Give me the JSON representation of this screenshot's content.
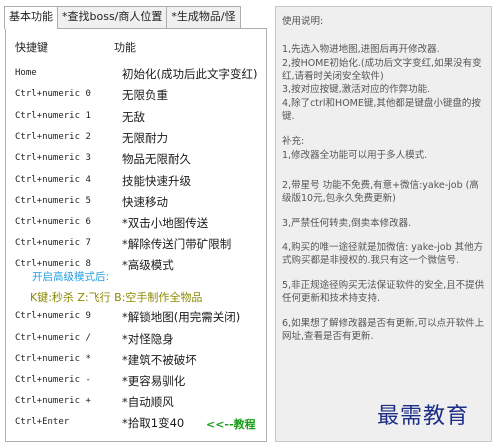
{
  "tabs": [
    {
      "label": "基本功能"
    },
    {
      "label": "*查找boss/商人位置"
    },
    {
      "label": "*生成物品/怪"
    }
  ],
  "table": {
    "key_header": "快捷键",
    "func_header": "功能",
    "rows": [
      {
        "key": "Home",
        "func": "初始化(成功后此文字变红)"
      },
      {
        "key": "Ctrl+numeric 0",
        "func": "无限负重"
      },
      {
        "key": "Ctrl+numeric 1",
        "func": "无敌"
      },
      {
        "key": "Ctrl+numeric 2",
        "func": "无限耐力"
      },
      {
        "key": "Ctrl+numeric 3",
        "func": "物品无限耐久"
      },
      {
        "key": "Ctrl+numeric 4",
        "func": "技能快速升级"
      },
      {
        "key": "Ctrl+numeric 5",
        "func": "快速移动"
      },
      {
        "key": "Ctrl+numeric 6",
        "func": "*双击小地图传送"
      },
      {
        "key": "Ctrl+numeric 7",
        "func": "*解除传送门带矿限制"
      },
      {
        "key": "Ctrl+numeric 8",
        "func": "*高级模式"
      }
    ],
    "advanced_title": "开启高级模式后:",
    "advanced_keys": "K键:秒杀  Z:飞行  B:空手制作全物品",
    "rows2": [
      {
        "key": "Ctrl+numeric 9",
        "func": "*解锁地图(用完需关闭)"
      },
      {
        "key": "Ctrl+numeric /",
        "func": "*对怪隐身"
      },
      {
        "key": "Ctrl+numeric *",
        "func": "*建筑不被破坏"
      },
      {
        "key": "Ctrl+numeric -",
        "func": "*更容易驯化"
      },
      {
        "key": "Ctrl+numeric +",
        "func": "*自动顺风"
      },
      {
        "key": "Ctrl+Enter",
        "func": "*拾取1变40",
        "link": "<<--教程"
      }
    ]
  },
  "instructions": {
    "title": "使用说明:",
    "p1": "1,先选入物进地图,进图后再开修改器.",
    "p2": "2,按HOME初始化.(成功后文字变红,如果没有变红,请看时关闭安全软件)",
    "p3": "3,按对应按键,激活对应的作弊功能.",
    "p4": "4,除了ctrl和HOME键,其他都是键盘小键盘的按键.",
    "supp_title": "补充:",
    "s1": "1,修改器全功能可以用于多人模式.",
    "s2": "2,带星号 功能不免费,有意+微信:yake-job (高级版10元,包永久免费更新)",
    "s3": "3,严禁任何转卖,倒卖本修改器.",
    "s4": "4,购买的唯一途径就是加微信: yake-job 其他方式购买都是非授权的.我只有这一个微信号.",
    "s5": "5,非正规途径购买无法保证软件的安全,且不提供任何更新和技术持支持.",
    "s6": "6,如果想了解修改器是否有更新,可以点开软件上网址,查看是否有更新."
  },
  "watermark": "最需教育"
}
